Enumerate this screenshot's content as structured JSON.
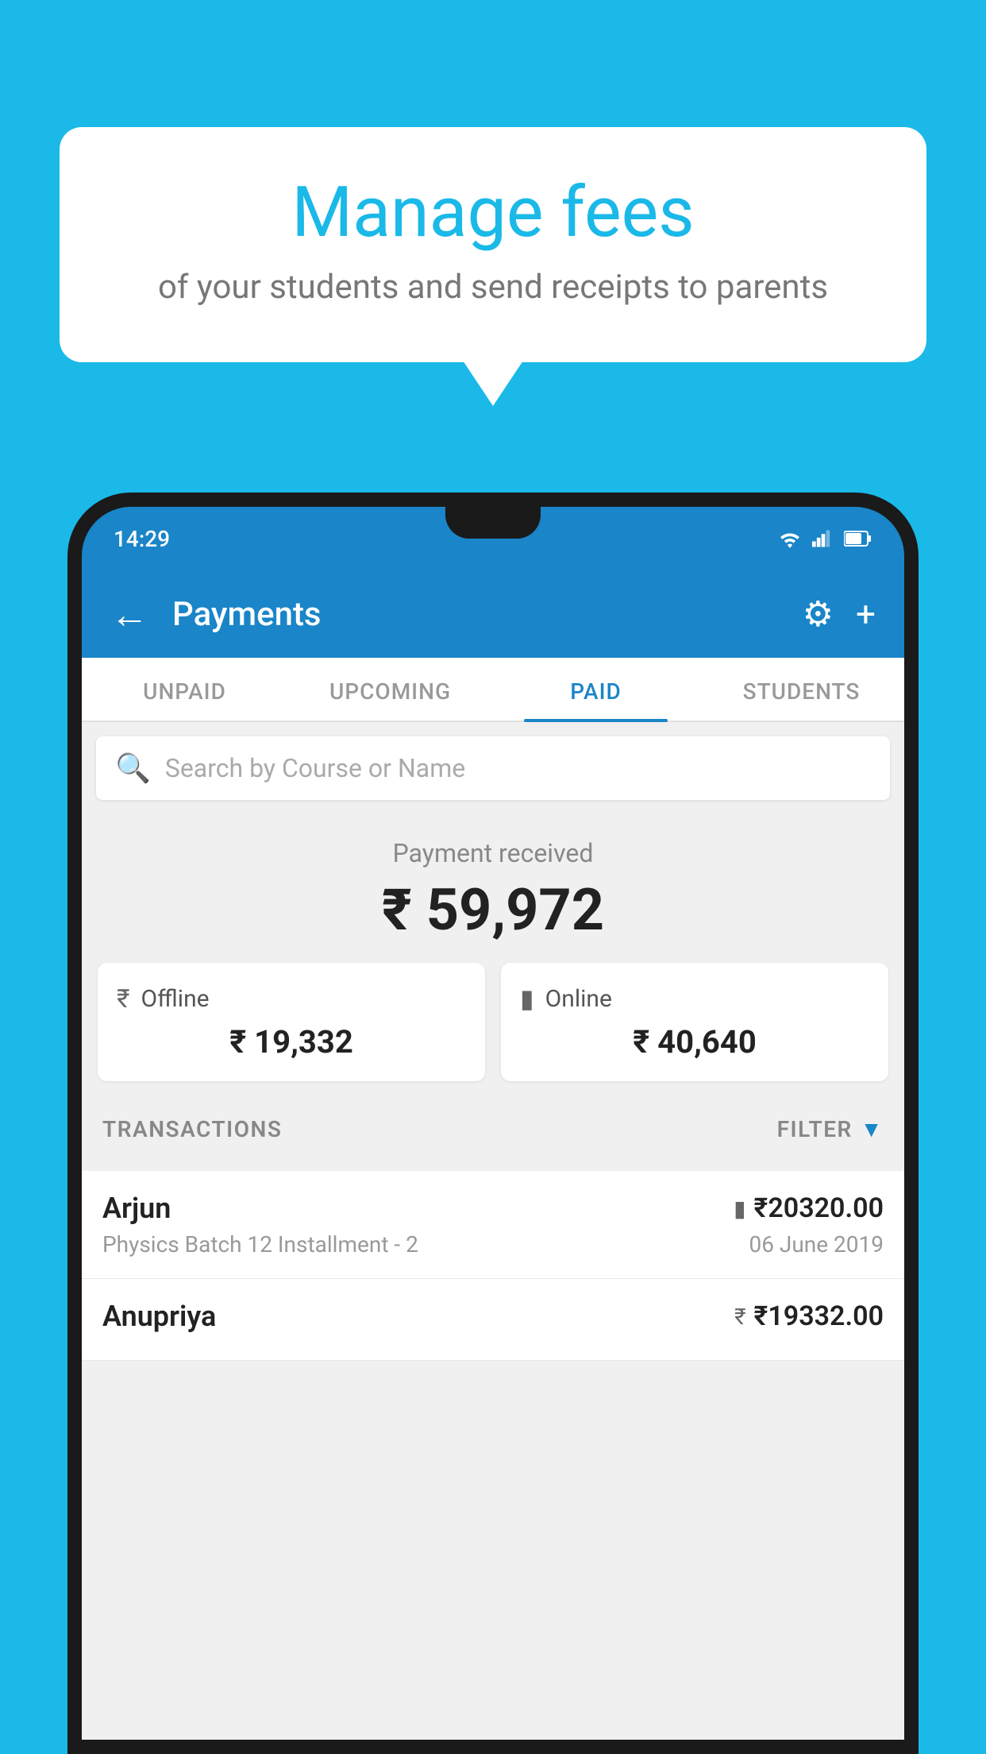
{
  "background_color": "#1ab9e8",
  "bubble": {
    "title": "Manage fees",
    "subtitle": "of your students and send receipts to parents"
  },
  "status_bar": {
    "time": "14:29"
  },
  "app_bar": {
    "title": "Payments",
    "back_label": "←",
    "settings_label": "⚙",
    "add_label": "+"
  },
  "tabs": [
    {
      "id": "unpaid",
      "label": "UNPAID",
      "active": false
    },
    {
      "id": "upcoming",
      "label": "UPCOMING",
      "active": false
    },
    {
      "id": "paid",
      "label": "PAID",
      "active": true
    },
    {
      "id": "students",
      "label": "STUDENTS",
      "active": false
    }
  ],
  "search": {
    "placeholder": "Search by Course or Name"
  },
  "payment": {
    "label": "Payment received",
    "amount": "₹ 59,972",
    "offline": {
      "type": "Offline",
      "amount": "₹ 19,332"
    },
    "online": {
      "type": "Online",
      "amount": "₹ 40,640"
    }
  },
  "transactions_label": "TRANSACTIONS",
  "filter_label": "FILTER",
  "transactions": [
    {
      "name": "Arjun",
      "description": "Physics Batch 12 Installment - 2",
      "amount": "₹20320.00",
      "date": "06 June 2019",
      "pay_method": "card"
    },
    {
      "name": "Anupriya",
      "description": "",
      "amount": "₹19332.00",
      "date": "",
      "pay_method": "cash"
    }
  ]
}
